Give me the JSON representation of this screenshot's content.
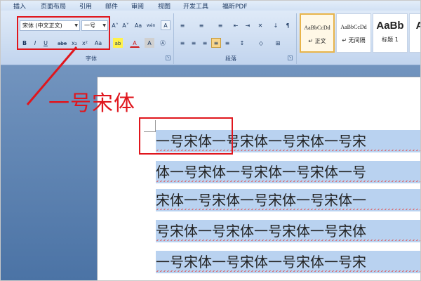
{
  "menu": {
    "tabs": [
      "插入",
      "页面布局",
      "引用",
      "邮件",
      "审阅",
      "视图",
      "开发工具",
      "福昕PDF"
    ]
  },
  "font_group": {
    "font_name": "宋体 (中文正文)",
    "font_size": "一号",
    "label": "字体",
    "buttons": [
      "A˄",
      "A˅",
      "Aa",
      "wén",
      "A",
      "B",
      "I",
      "U",
      "abe",
      "x₂",
      "x²",
      "Aa",
      "ab",
      "A",
      "A",
      "Ⓐ"
    ]
  },
  "paragraph_group": {
    "label": "段落"
  },
  "styles": [
    {
      "sample": "AaBbCcDd",
      "name": "↵ 正文",
      "selected": true
    },
    {
      "sample": "AaBbCcDd",
      "name": "↵ 无间隔",
      "selected": false
    },
    {
      "sample": "AaBb",
      "name": "标题 1",
      "selected": false
    },
    {
      "sample": "A",
      "name": "",
      "selected": false
    }
  ],
  "annotation": {
    "label": "一号宋体"
  },
  "document": {
    "lines": [
      "一号宋体一号宋体一号宋体一号宋",
      "体一号宋体一号宋体一号宋体一号",
      "宋体一号宋体一号宋体一号宋体一",
      "号宋体一号宋体一号宋体一号宋体",
      "一号宋体一号宋体一号宋体一号宋"
    ]
  },
  "colors": {
    "highlight": "#b9d2f0",
    "annotation_red": "#e0161d",
    "ribbon_top": "#dfeaf8"
  }
}
